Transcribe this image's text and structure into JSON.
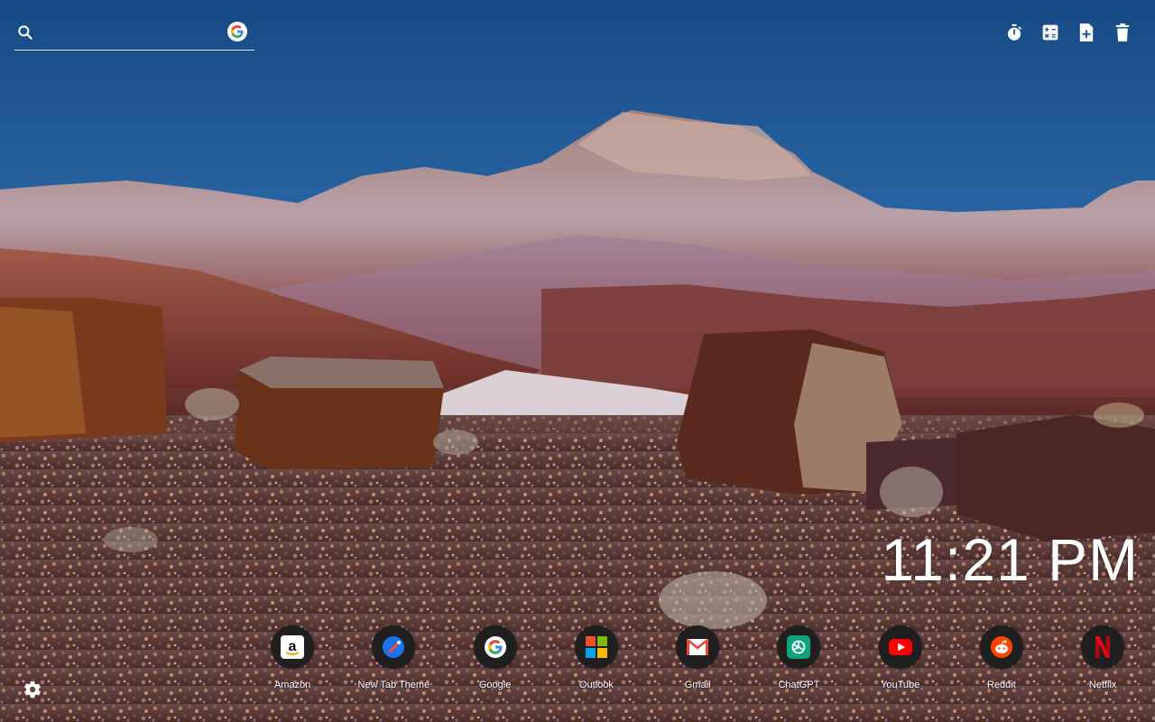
{
  "search": {
    "placeholder": "",
    "value": "",
    "engine_icon": "google-icon"
  },
  "toolbar": {
    "buttons": [
      {
        "icon": "timer-icon"
      },
      {
        "icon": "calculator-icon"
      },
      {
        "icon": "add-note-icon"
      },
      {
        "icon": "trash-icon"
      }
    ]
  },
  "clock": {
    "time": "11:21 PM"
  },
  "shortcuts": [
    {
      "label": "Amazon",
      "icon": "amazon-icon"
    },
    {
      "label": "New Tab Theme",
      "icon": "new-tab-theme-icon"
    },
    {
      "label": "Google",
      "icon": "google-icon"
    },
    {
      "label": "Outlook",
      "icon": "microsoft-icon"
    },
    {
      "label": "Gmail",
      "icon": "gmail-icon"
    },
    {
      "label": "ChatGPT",
      "icon": "chatgpt-icon"
    },
    {
      "label": "YouTube",
      "icon": "youtube-icon"
    },
    {
      "label": "Reddit",
      "icon": "reddit-icon"
    },
    {
      "label": "Netflix",
      "icon": "netflix-icon"
    }
  ],
  "settings": {
    "icon": "gear-icon"
  },
  "colors": {
    "sky_top": "#1a4f8c",
    "sky_bottom": "#4a8fc8",
    "accent_google_blue": "#4285f4",
    "youtube_red": "#ff0000",
    "reddit_orange": "#ff4500",
    "netflix_red": "#e50914"
  }
}
